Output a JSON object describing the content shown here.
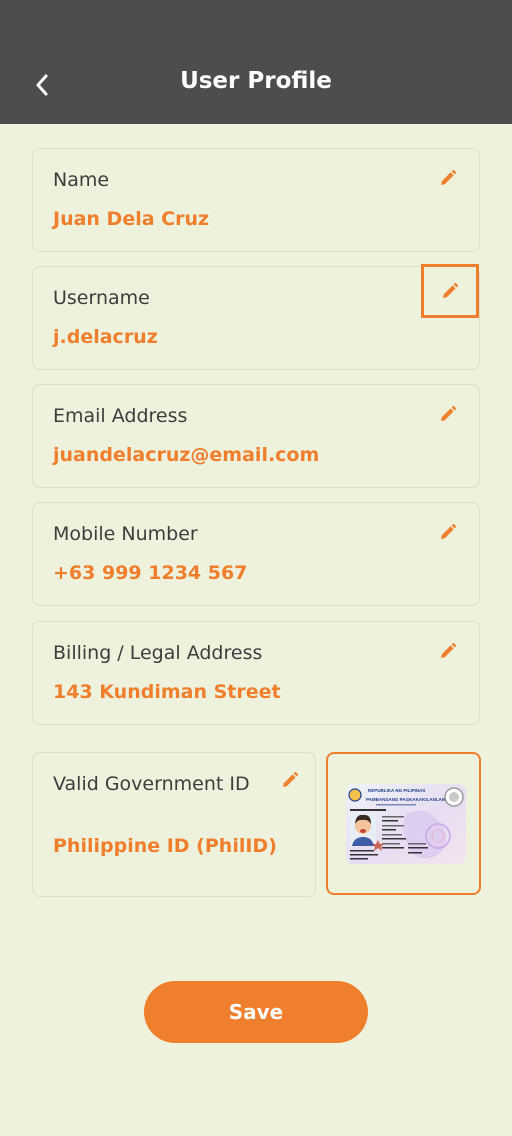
{
  "header": {
    "title": "User Profile"
  },
  "fields": [
    {
      "label": "Name",
      "value": "Juan Dela Cruz"
    },
    {
      "label": "Username",
      "value": "j.delacruz"
    },
    {
      "label": "Email Address",
      "value": "juandelacruz@email.com"
    },
    {
      "label": "Mobile Number",
      "value": "+63 999 1234 567"
    },
    {
      "label": "Billing / Legal Address",
      "value": "143 Kundiman Street"
    }
  ],
  "government_id": {
    "label": "Valid Government ID",
    "value": "Philippine ID (PhilID)",
    "card": {
      "header_line1": "REPUBLIKA NG PILIPINAS",
      "header_line2": "PAMBANSANG PAGKAKAKILANLAN"
    }
  },
  "save_label": "Save",
  "colors": {
    "accent": "#ef7f2d",
    "header": "#4d4d4d",
    "background": "#eef2dc"
  },
  "icons": {
    "back": "chevron-left-icon",
    "edit": "pencil-icon"
  }
}
